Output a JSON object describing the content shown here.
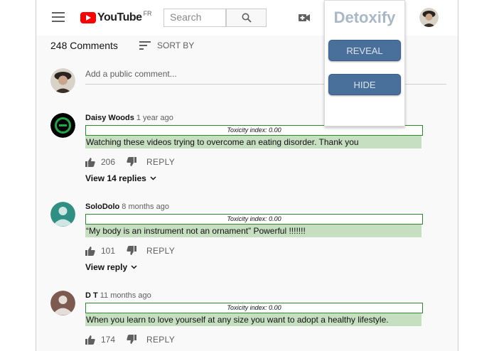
{
  "header": {
    "logo_text": "YouTube",
    "logo_region": "FR",
    "search_placeholder": "Search"
  },
  "detoxify": {
    "title": "Detoxify",
    "reveal_label": "REVEAL",
    "hide_label": "HIDE"
  },
  "comments_section": {
    "count_label": "248 Comments",
    "sort_label": "SORT BY",
    "add_comment_placeholder": "Add a public comment..."
  },
  "comments": [
    {
      "author": "Daisy Woods",
      "time": "1 year ago",
      "toxicity": "Toxicity index: 0.00",
      "text": "Watching these videos trying to overcome an eating disorder. Thank you",
      "likes": "206",
      "reply_label": "REPLY",
      "replies_label": "View 14 replies"
    },
    {
      "author": "SoloDolo",
      "time": "8 months ago",
      "toxicity": "Toxicity index: 0.00",
      "text": "“My body is an instrument not an ornament” Powerful !!!!!!!",
      "likes": "101",
      "reply_label": "REPLY",
      "replies_label": "View reply"
    },
    {
      "author": "D T",
      "time": "11 months ago",
      "toxicity": "Toxicity index: 0.00",
      "text": "When you learn to love yourself at any size you want to adopt a healthy lifestyle.",
      "likes": "174",
      "reply_label": "REPLY"
    }
  ],
  "colors": {
    "detox_button": "#49709b",
    "toxicity_highlight": "#c7dfc1",
    "toxicity_border": "#2b8a2b",
    "youtube_red": "#ff0000"
  }
}
